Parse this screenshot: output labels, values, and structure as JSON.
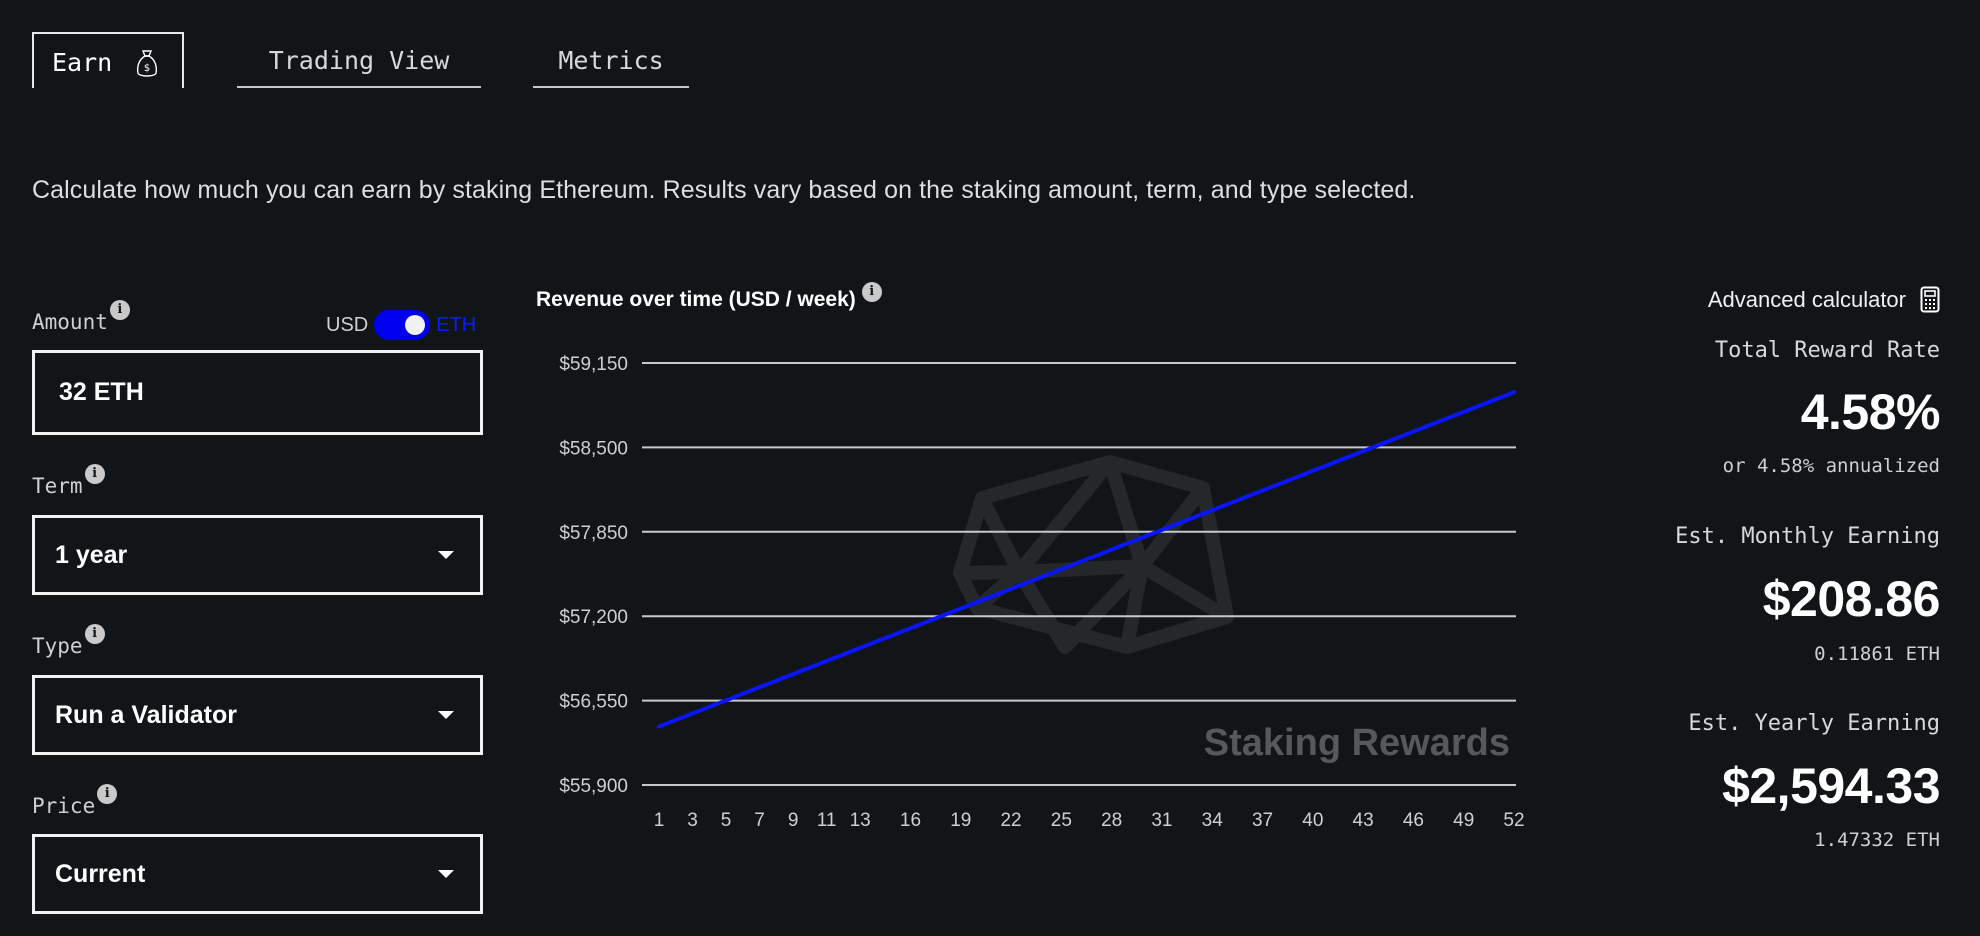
{
  "tabs": [
    {
      "label": "Earn",
      "icon": "money-bag-icon",
      "active": true
    },
    {
      "label": "Trading View",
      "active": false
    },
    {
      "label": "Metrics",
      "active": false
    }
  ],
  "description": "Calculate how much you can earn by staking Ethereum. Results vary based on the staking amount, term, and type selected.",
  "form": {
    "amount": {
      "label": "Amount",
      "value": "32 ETH"
    },
    "currency_toggle": {
      "left": "USD",
      "right": "ETH",
      "selected": "ETH"
    },
    "term": {
      "label": "Term",
      "value": "1 year"
    },
    "type": {
      "label": "Type",
      "value": "Run a Validator"
    },
    "price": {
      "label": "Price",
      "value": "Current"
    },
    "info_glyph": "i"
  },
  "watermark": {
    "text": "Staking Rewards"
  },
  "colors": {
    "accent": "#0000f0",
    "line": "#0a14ff",
    "grid": "#c8c8c8",
    "background": "#121518"
  },
  "right": {
    "advanced_calculator": "Advanced calculator",
    "total_reward_rate": {
      "label": "Total Reward Rate",
      "value": "4.58%",
      "sub": "or 4.58% annualized"
    },
    "monthly": {
      "label": "Est. Monthly Earning",
      "value": "$208.86",
      "sub": "0.11861 ETH"
    },
    "yearly": {
      "label": "Est. Yearly Earning",
      "value": "$2,594.33",
      "sub": "1.47332 ETH"
    }
  },
  "chart_data": {
    "type": "line",
    "title": "Revenue over time (USD / week)",
    "xlabel": "",
    "ylabel": "",
    "x_ticks": [
      1,
      3,
      5,
      7,
      9,
      11,
      13,
      16,
      19,
      22,
      25,
      28,
      31,
      34,
      37,
      40,
      43,
      46,
      49,
      52
    ],
    "y_ticks": [
      55900,
      56550,
      57200,
      57850,
      58500,
      59150
    ],
    "y_tick_labels": [
      "$55,900",
      "$56,550",
      "$57,200",
      "$57,850",
      "$58,500",
      "$59,150"
    ],
    "xlim": [
      1,
      52
    ],
    "ylim": [
      55900,
      59150
    ],
    "grid": "horizontal",
    "series": [
      {
        "name": "Revenue",
        "x": [
          1,
          52
        ],
        "values": [
          56350,
          58925
        ]
      }
    ]
  }
}
